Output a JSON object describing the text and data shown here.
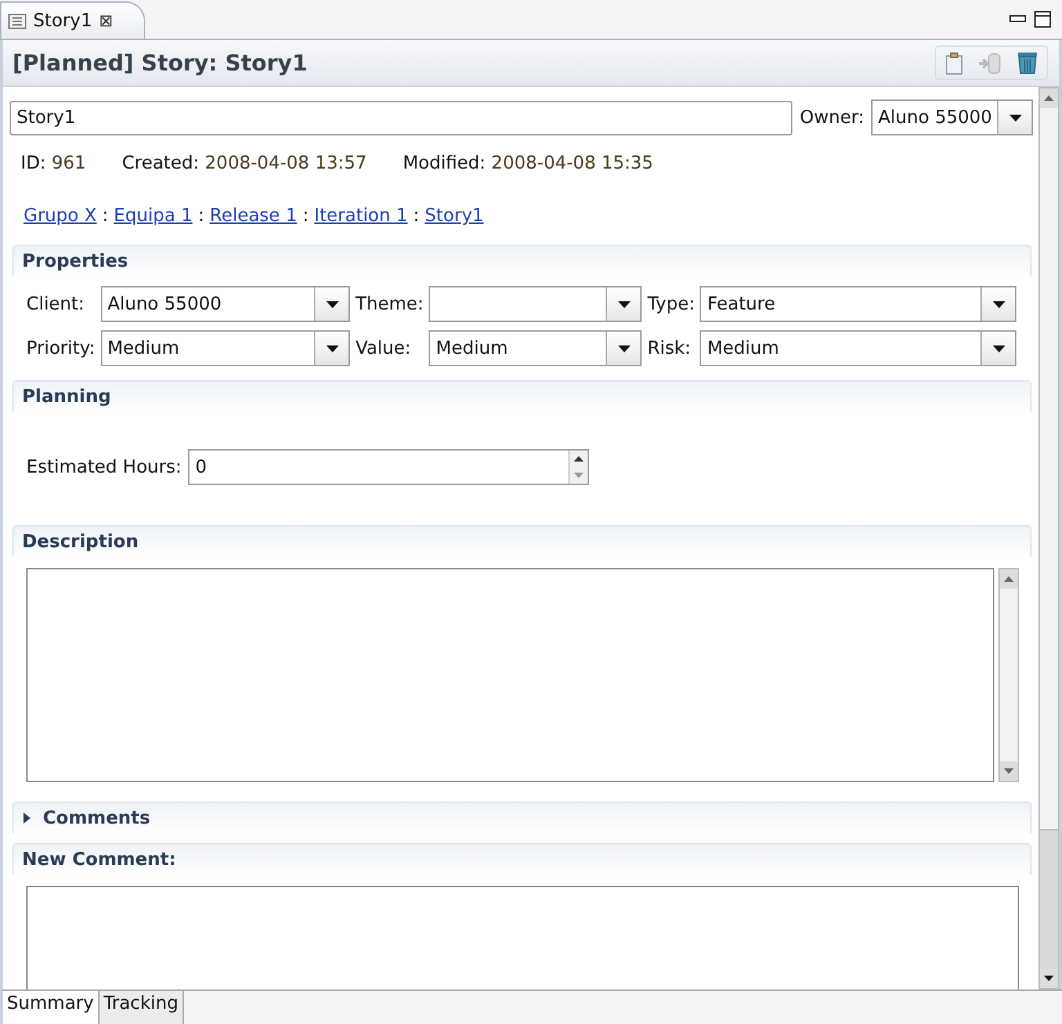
{
  "editor_tab": {
    "label": "Story1",
    "close": "⊠"
  },
  "header": {
    "title": "[Planned] Story: Story1"
  },
  "name_field": {
    "value": "Story1"
  },
  "owner": {
    "label": "Owner:",
    "value": "Aluno 55000"
  },
  "meta": [
    {
      "label": "ID:",
      "value": "961"
    },
    {
      "label": "Created:",
      "value": "2008-04-08 13:57"
    },
    {
      "label": "Modified:",
      "value": "2008-04-08 15:35"
    }
  ],
  "breadcrumb": [
    {
      "label": "Grupo X"
    },
    {
      "label": "Equipa 1"
    },
    {
      "label": "Release 1"
    },
    {
      "label": "Iteration 1"
    },
    {
      "label": "Story1"
    }
  ],
  "breadcrumb_separator": ":",
  "properties": {
    "title": "Properties",
    "fields": [
      {
        "label": "Client:",
        "value": "Aluno 55000"
      },
      {
        "label": "Theme:"
      },
      {
        "label": "Type:",
        "value": "Feature"
      },
      {
        "label": "Priority:",
        "value": "Medium"
      },
      {
        "label": "Value:",
        "value": "Medium"
      },
      {
        "label": "Risk:",
        "value": "Medium"
      }
    ]
  },
  "planning": {
    "title": "Planning",
    "estimated_hours": {
      "label": "Estimated Hours:",
      "value": "0"
    }
  },
  "description": {
    "title": "Description"
  },
  "comments": {
    "title": "Comments",
    "expanded": false
  },
  "new_comment": {
    "title": "New Comment:"
  },
  "bottom_tabs": [
    {
      "label": "Summary",
      "selected": true
    },
    {
      "label": "Tracking",
      "selected": false
    }
  ]
}
